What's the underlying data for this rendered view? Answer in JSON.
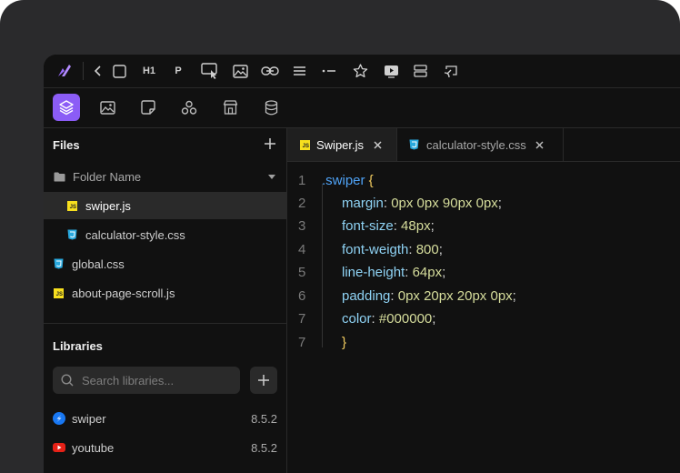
{
  "toolbar": {
    "items": [
      {
        "name": "back-icon",
        "label": ""
      },
      {
        "name": "square-icon",
        "label": ""
      },
      {
        "name": "h1-button",
        "label": "H1"
      },
      {
        "name": "p-button",
        "label": "P"
      },
      {
        "name": "monitor-cursor-icon",
        "label": ""
      },
      {
        "name": "image-icon",
        "label": ""
      },
      {
        "name": "link-icon",
        "label": ""
      },
      {
        "name": "align-icon",
        "label": ""
      },
      {
        "name": "dash-icon",
        "label": ""
      },
      {
        "name": "star-icon",
        "label": ""
      },
      {
        "name": "play-icon",
        "label": ""
      },
      {
        "name": "layout-icon",
        "label": ""
      },
      {
        "name": "cast-icon",
        "label": ""
      }
    ]
  },
  "accent": "#8b5cf6",
  "sidebar": {
    "files_title": "Files",
    "folder_name": "Folder Name",
    "files": [
      {
        "name": "swiper.js",
        "type": "js",
        "nested": true,
        "selected": true
      },
      {
        "name": "calculator-style.css",
        "type": "css",
        "nested": true,
        "selected": false
      },
      {
        "name": "global.css",
        "type": "css",
        "nested": false,
        "selected": false
      },
      {
        "name": "about-page-scroll.js",
        "type": "js",
        "nested": false,
        "selected": false
      }
    ],
    "libraries_title": "Libraries",
    "search_placeholder": "Search libraries...",
    "libraries": [
      {
        "name": "swiper",
        "version": "8.5.2",
        "color": "#1877f2"
      },
      {
        "name": "youtube",
        "version": "8.5.2",
        "color": "#e62117"
      }
    ]
  },
  "editor": {
    "tabs": [
      {
        "label": "Swiper.js",
        "type": "js",
        "active": true
      },
      {
        "label": "calculator-style.css",
        "type": "css",
        "active": false
      }
    ],
    "code": {
      "selector": ".swiper",
      "declarations": [
        {
          "prop": "margin",
          "value": "0px 0px 90px 0px"
        },
        {
          "prop": "font-size",
          "value": "48px"
        },
        {
          "prop": "font-weigth",
          "value": "800"
        },
        {
          "prop": "line-height",
          "value": "64px"
        },
        {
          "prop": "padding",
          "value": "0px 20px 20px 0px"
        },
        {
          "prop": "color",
          "value": "#000000"
        }
      ],
      "line_numbers": [
        "1",
        "2",
        "3",
        "4",
        "5",
        "6",
        "7",
        "7"
      ]
    }
  }
}
